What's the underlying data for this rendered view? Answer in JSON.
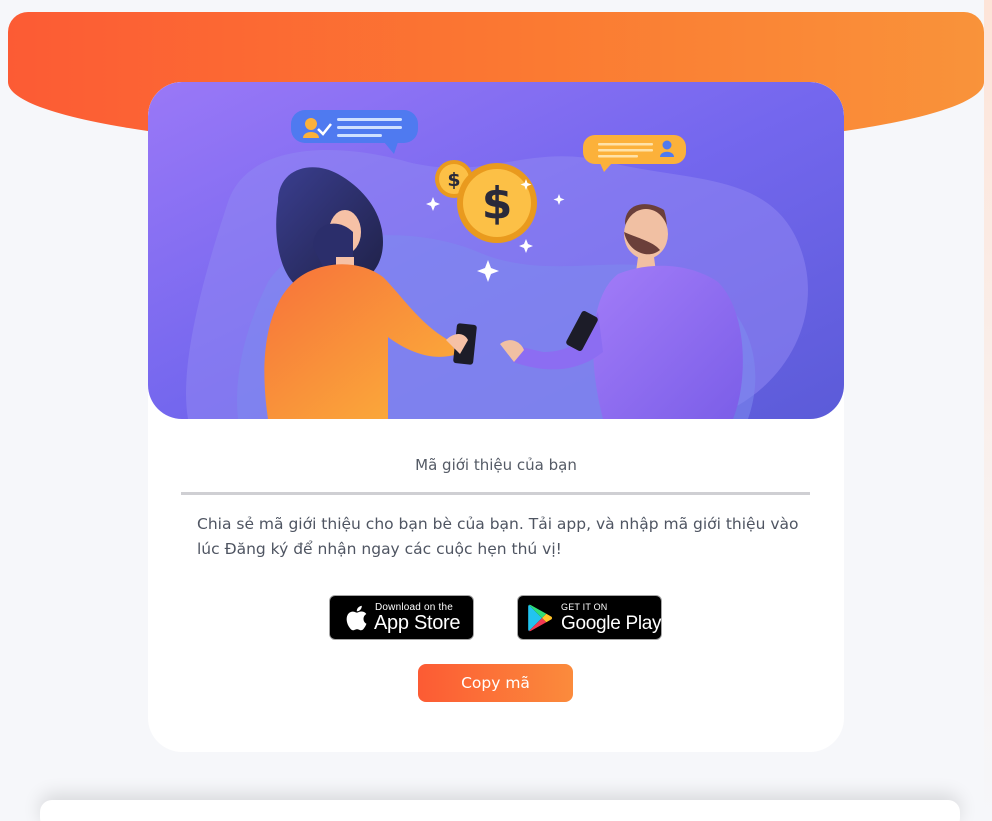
{
  "colors": {
    "accent_start": "#fc5b34",
    "accent_end": "#f9933a",
    "hero_bg": "#7b6ff0",
    "page_bg": "#f6f7fa"
  },
  "hero": {
    "icon": "referral-illustration"
  },
  "referral": {
    "title": "Mã giới thiệu của bạn",
    "description": "Chia sẻ mã giới thiệu cho bạn bè của bạn. Tải app, và nhập mã giới thiệu vào lúc Đăng ký để nhận ngay các cuộc hẹn thú vị!"
  },
  "stores": {
    "appstore": {
      "small": "Download on the",
      "big": "App Store",
      "icon": "apple-icon"
    },
    "googleplay": {
      "small": "GET IT ON",
      "big": "Google Play",
      "icon": "google-play-icon"
    }
  },
  "actions": {
    "copy_label": "Copy mã"
  }
}
